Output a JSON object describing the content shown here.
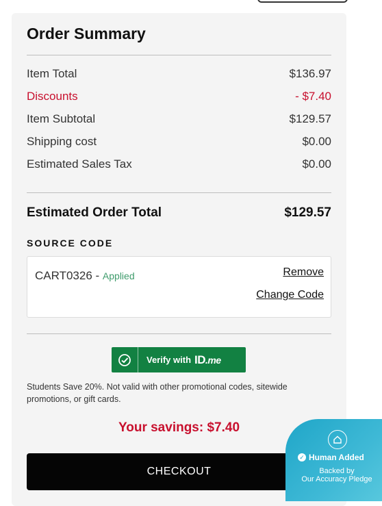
{
  "summary": {
    "title": "Order Summary",
    "rows": [
      {
        "label": "Item Total",
        "value": "$136.97"
      },
      {
        "label": "Discounts",
        "value": "- $7.40"
      },
      {
        "label": "Item Subtotal",
        "value": "$129.57"
      },
      {
        "label": "Shipping cost",
        "value": "$0.00"
      },
      {
        "label": "Estimated Sales Tax",
        "value": "$0.00"
      }
    ],
    "total_label": "Estimated Order Total",
    "total_value": "$129.57"
  },
  "source_code": {
    "heading": "SOURCE CODE",
    "code": "CART0326",
    "separator": " - ",
    "status": "Applied",
    "remove_label": "Remove",
    "change_label": "Change Code"
  },
  "idme": {
    "label": "Verify with",
    "logo": "ID",
    "logo_suffix": ".me",
    "note": "Students Save 20%. Not valid with other promotional codes, sitewide promotions, or gift cards."
  },
  "savings": "Your savings: $7.40",
  "checkout_label": "CHECKOUT",
  "badge": {
    "title": "Human Added",
    "line1": "Backed by",
    "line2": "Our Accuracy Pledge"
  },
  "colors": {
    "discount": "#c8102e",
    "applied": "#3e9b6b",
    "idme_green": "#128142",
    "checkout_bg": "#050505",
    "badge_teal": "#1fa6c8"
  }
}
